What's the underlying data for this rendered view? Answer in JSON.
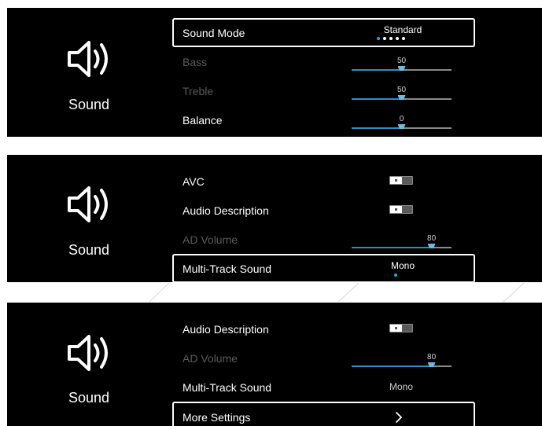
{
  "panels": [
    {
      "side_label": "Sound",
      "rows": [
        {
          "label": "Sound Mode",
          "value": "Standard",
          "dots": 5,
          "active_dot": 0
        },
        {
          "label": "Bass",
          "value": "50",
          "level": 50
        },
        {
          "label": "Treble",
          "value": "50",
          "level": 50
        },
        {
          "label": "Balance",
          "value": "0",
          "level": 50
        }
      ]
    },
    {
      "side_label": "Sound",
      "rows": [
        {
          "label": "AVC",
          "toggle": "off"
        },
        {
          "label": "Audio Description",
          "toggle": "off"
        },
        {
          "label": "AD Volume",
          "value": "80",
          "level": 80
        },
        {
          "label": "Multi-Track Sound",
          "value": "Mono",
          "dots": 1,
          "active_dot": 0
        }
      ]
    },
    {
      "side_label": "Sound",
      "rows": [
        {
          "label": "Audio Description",
          "toggle": "off"
        },
        {
          "label": "AD Volume",
          "value": "80",
          "level": 80
        },
        {
          "label": "Multi-Track Sound",
          "value": "Mono"
        },
        {
          "label": "More Settings",
          "icon": "chevron-right-icon"
        }
      ]
    }
  ],
  "colors": {
    "panel_bg": "#000000",
    "text": "#ffffff",
    "dim_text": "#5a5a5a",
    "accent": "#25a6e0",
    "slider_fill": "#2a8fc0",
    "track": "#8a8a8a"
  },
  "icons": [
    "speaker-icon",
    "chevron-right-icon"
  ]
}
